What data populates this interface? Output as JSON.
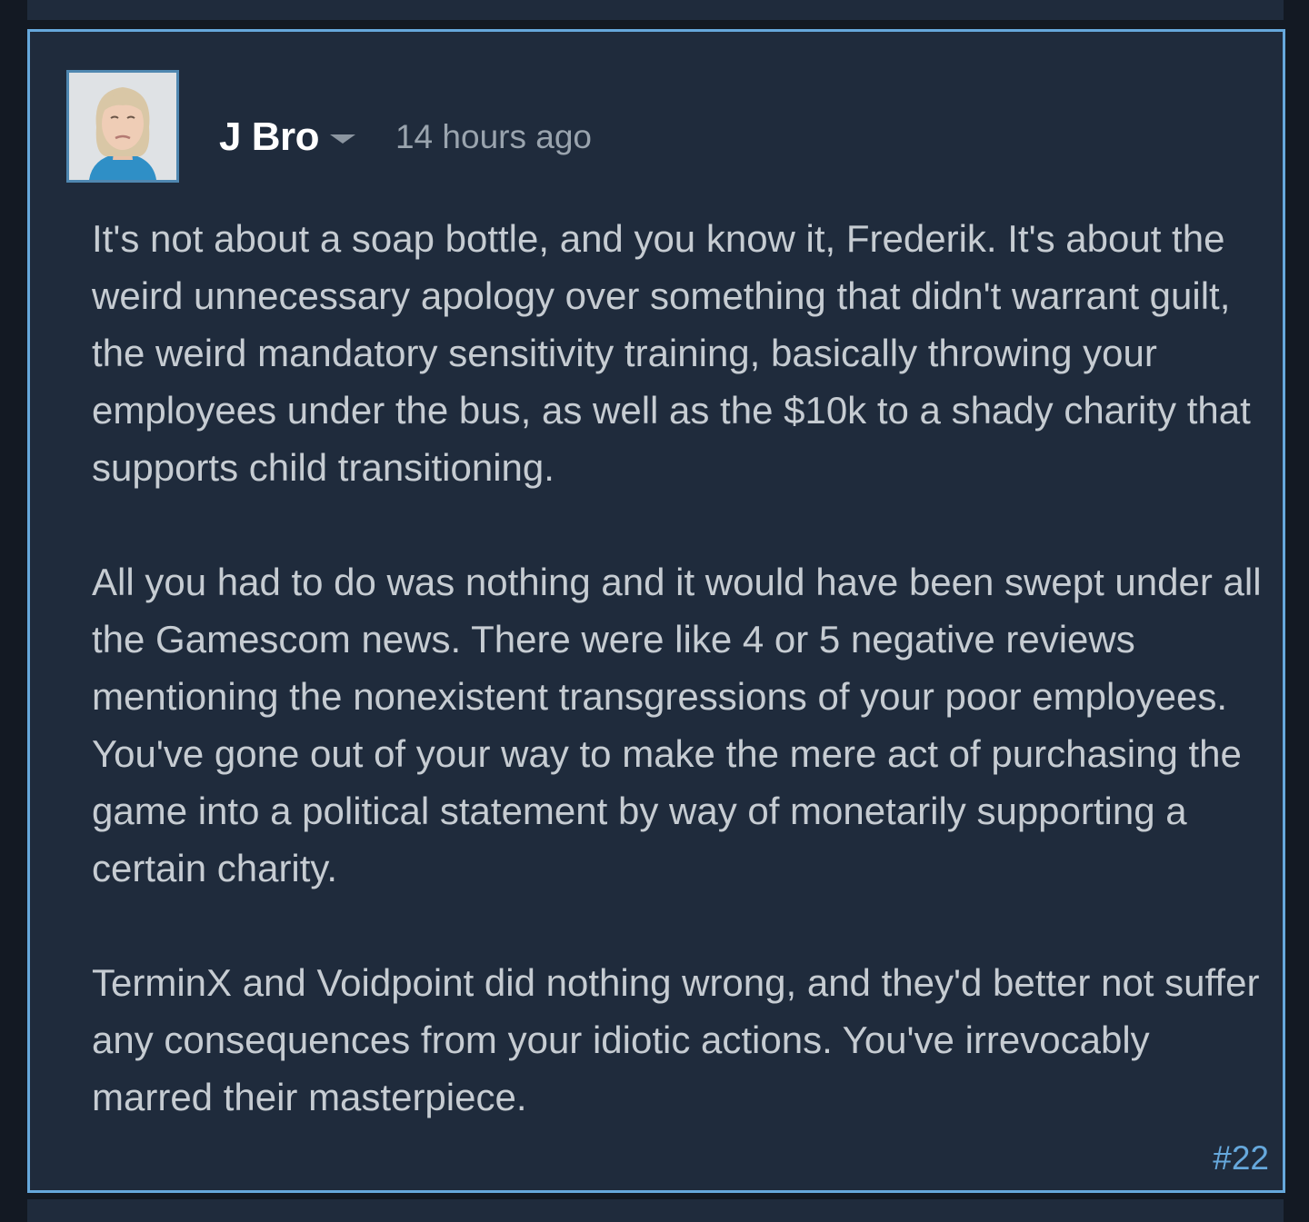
{
  "comment": {
    "author": "J Bro",
    "timestamp": "14 hours ago",
    "post_number": "#22",
    "icons": {
      "author_menu": "chevron-down-icon",
      "avatar": "user-avatar"
    },
    "colors": {
      "card_bg": "#1f2b3c",
      "highlight_border": "#66a8dc",
      "page_bg": "#131923",
      "body_text": "#c6ccd2",
      "meta_text": "#9aa4ae"
    },
    "paragraphs": [
      "It's not about a soap bottle, and you know it, Frederik. It's about the weird unnecessary apology over something that didn't warrant guilt, the weird mandatory sensitivity training, basically throwing your employees under the bus, as well as the $10k to a shady charity that supports child transitioning.",
      "All you had to do was nothing and it would have been swept under all the Gamescom news. There were like 4 or 5 negative reviews mentioning the nonexistent transgressions of your poor employees. You've gone out of your way to make the mere act of purchasing the game into a political statement by way of monetarily supporting a certain charity.",
      "TerminX and Voidpoint did nothing wrong, and they'd better not suffer any consequences from your idiotic actions. You've irrevocably marred their masterpiece."
    ]
  }
}
